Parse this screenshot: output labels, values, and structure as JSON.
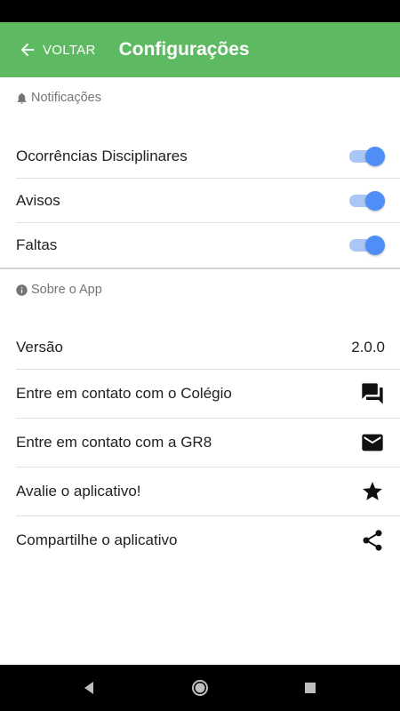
{
  "app_bar": {
    "back_label": "VOLTAR",
    "title": "Configurações",
    "color": "#5dba62"
  },
  "notifications": {
    "header": "Notificações",
    "items": [
      {
        "label": "Ocorrências Disciplinares",
        "enabled": true
      },
      {
        "label": "Avisos",
        "enabled": true
      },
      {
        "label": "Faltas",
        "enabled": true
      }
    ]
  },
  "about": {
    "header": "Sobre o App",
    "version_label": "Versão",
    "version_value": "2.0.0",
    "items": [
      {
        "label": "Entre em contato com o Colégio",
        "icon": "chat-icon"
      },
      {
        "label": "Entre em contato com a GR8",
        "icon": "mail-icon"
      },
      {
        "label": "Avalie o aplicativo!",
        "icon": "star-icon"
      },
      {
        "label": "Compartilhe o aplicativo",
        "icon": "share-icon"
      }
    ]
  },
  "colors": {
    "switch_thumb": "#4f8ef7",
    "switch_track": "#a9c6f5"
  }
}
